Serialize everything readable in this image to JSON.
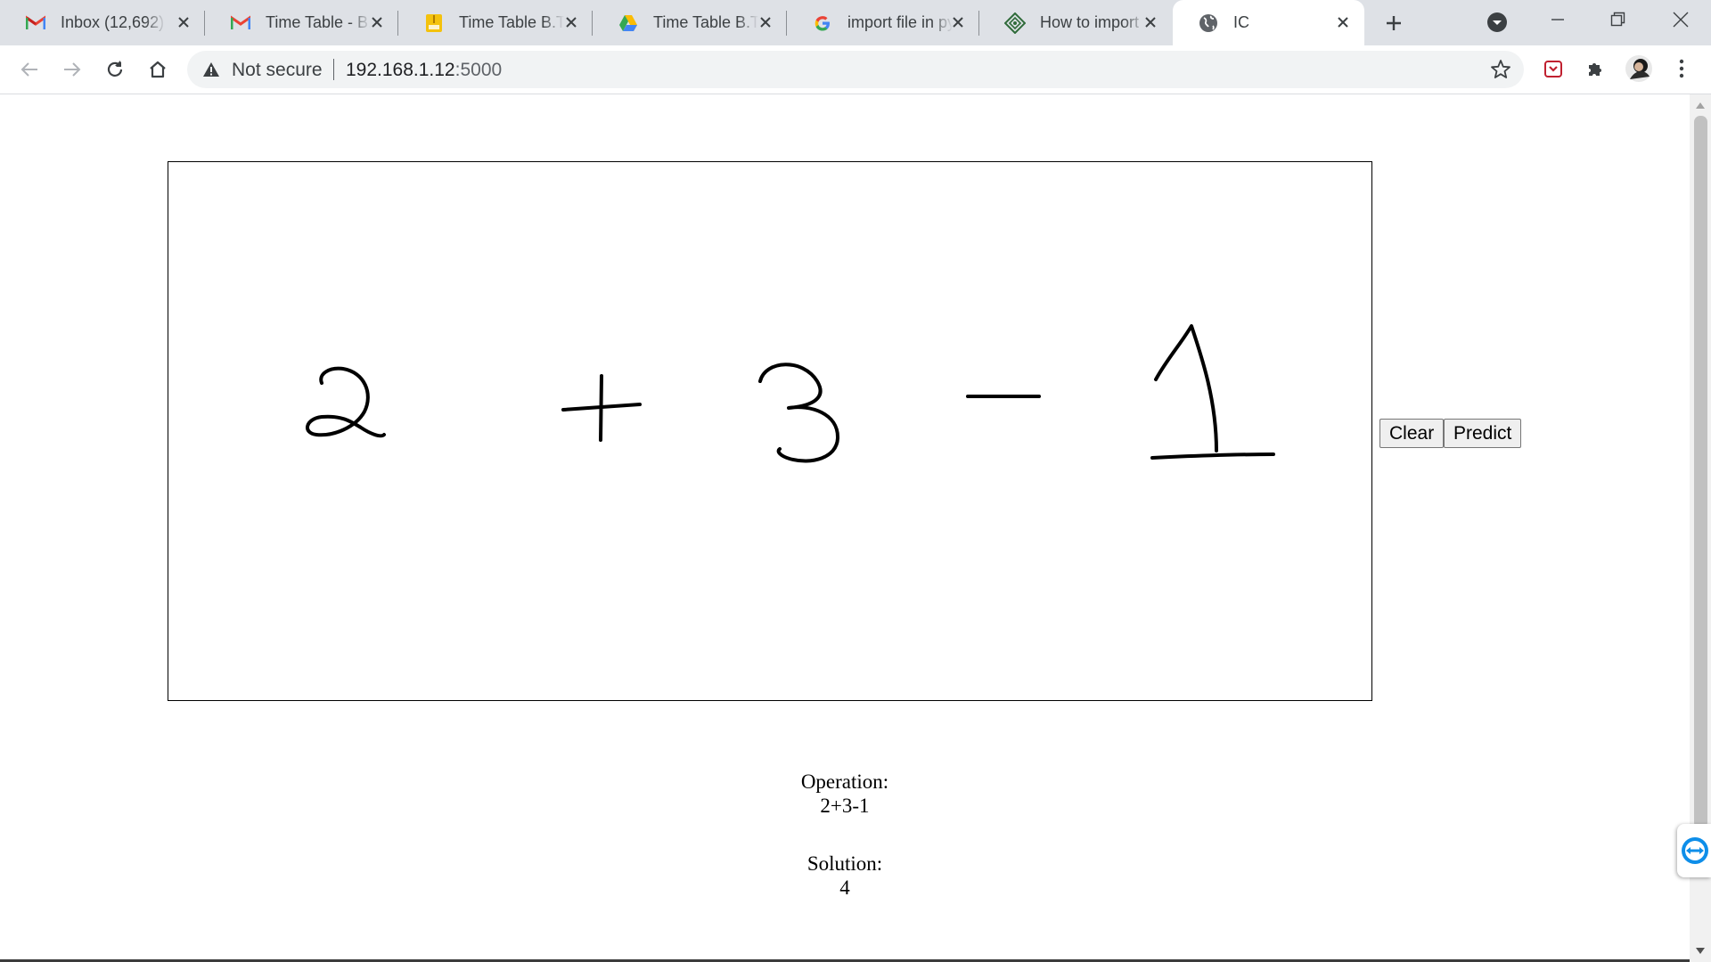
{
  "browser": {
    "tabs": [
      {
        "title": "Inbox (12,692)",
        "icon": "gmail-icon",
        "active": false
      },
      {
        "title": "Time Table - B.Tech",
        "icon": "gmail-icon",
        "active": false
      },
      {
        "title": "Time Table B.Tech",
        "icon": "zip-icon",
        "active": false
      },
      {
        "title": "Time Table B.Tech",
        "icon": "google-drive-icon",
        "active": false
      },
      {
        "title": "import file in python",
        "icon": "google-icon",
        "active": false
      },
      {
        "title": "How to import",
        "icon": "website-icon",
        "active": false
      },
      {
        "title": "IC",
        "icon": "globe-icon",
        "active": true
      }
    ],
    "address_bar": {
      "security_label": "Not secure",
      "host": "192.168.1.12",
      "port": ":5000"
    }
  },
  "page": {
    "canvas": {
      "drawn_expression": [
        "2",
        "+",
        "3",
        "-",
        "1"
      ]
    },
    "buttons": {
      "clear_label": "Clear",
      "predict_label": "Predict"
    },
    "operation": {
      "label": "Operation:",
      "value": "2+3-1"
    },
    "solution": {
      "label": "Solution:",
      "value": "4"
    }
  },
  "colors": {
    "tabstrip_bg": "#dee1e6",
    "omnibox_bg": "#f1f3f4",
    "ink": "#000000",
    "teamviewer_blue": "#0e8ee9"
  }
}
